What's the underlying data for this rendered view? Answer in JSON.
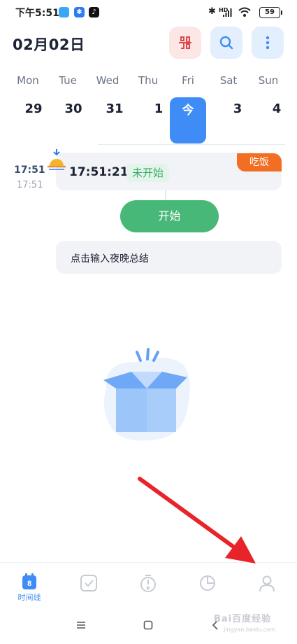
{
  "status_bar": {
    "time": "下午5:51",
    "network": "HD",
    "battery": "59"
  },
  "header": {
    "title": "02月02日",
    "icons": [
      "layout-toggle-icon",
      "search-icon",
      "more-vertical-icon"
    ]
  },
  "week": {
    "days": [
      {
        "dow": "Mon",
        "date": "29"
      },
      {
        "dow": "Tue",
        "date": "30"
      },
      {
        "dow": "Wed",
        "date": "31"
      },
      {
        "dow": "Thu",
        "date": "1"
      },
      {
        "dow": "Fri",
        "date": "今"
      },
      {
        "dow": "Sat",
        "date": "3"
      },
      {
        "dow": "Sun",
        "date": "4"
      }
    ],
    "selected_color": "#3f8cf7"
  },
  "timeline": {
    "time_main": "17:51",
    "time_sub": "17:51",
    "task": {
      "time": "17:51:21",
      "status": "未开始",
      "tag": "吃饭",
      "tag_color": "#f26e23",
      "icon": "sunrise-icon"
    },
    "start_button": "开始",
    "summary_placeholder": "点击输入夜晚总结"
  },
  "empty_state": {
    "icon": "empty-box-illustration"
  },
  "bottom_nav": {
    "items": [
      {
        "label": "时间线",
        "icon": "calendar-icon",
        "badge": "8",
        "active": true
      },
      {
        "icon": "checkbox-icon"
      },
      {
        "icon": "timer-icon"
      },
      {
        "icon": "pie-chart-icon"
      },
      {
        "icon": "profile-icon"
      }
    ],
    "active_color": "#3f8cf7"
  },
  "watermark": {
    "text": "Bai百度经验",
    "sub": "jingyan.baidu.com"
  }
}
